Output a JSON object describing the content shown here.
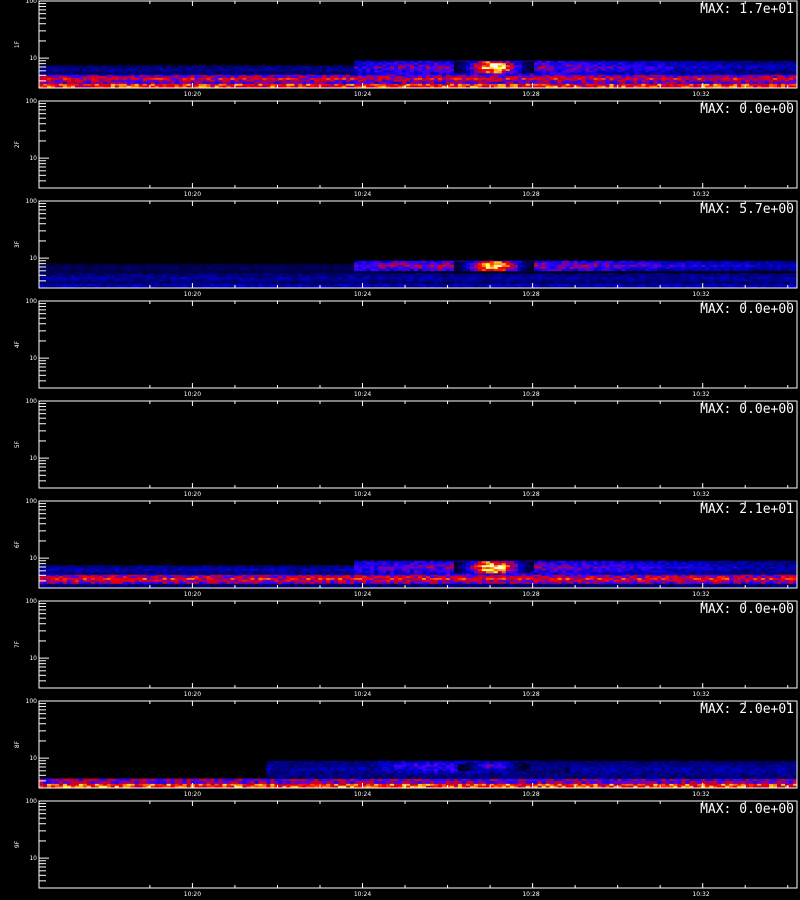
{
  "chart_data": [
    {
      "type": "heatmap",
      "panel_label": "1F",
      "max_label": "MAX: 1.7e+01",
      "max_value": 17,
      "y_ticklabels": [
        "100",
        "10"
      ],
      "x_ticklabels": [
        "10:20",
        "10:24",
        "10:28",
        "10:32"
      ],
      "features": [
        {
          "name": "baseline",
          "t": [
            0.0,
            1.0
          ],
          "y": [
            3.0,
            3.6
          ],
          "level": 0.9
        },
        {
          "name": "band2",
          "t": [
            0.0,
            1.0
          ],
          "y": [
            3.6,
            5.2
          ],
          "level": 0.55
        },
        {
          "name": "band3",
          "t": [
            0.0,
            0.45
          ],
          "y": [
            5.2,
            7.5
          ],
          "level": 0.18
        },
        {
          "name": "enhancement",
          "t": [
            0.42,
            1.0
          ],
          "y": [
            5.2,
            9.0
          ],
          "level": 0.45
        },
        {
          "name": "peak",
          "t": [
            0.55,
            0.65
          ],
          "y": [
            5.5,
            8.8
          ],
          "level": 1.0
        }
      ]
    },
    {
      "type": "heatmap",
      "panel_label": "2F",
      "max_label": "MAX: 0.0e+00",
      "max_value": 0,
      "y_ticklabels": [
        "100",
        "10"
      ],
      "x_ticklabels": [
        "10:20",
        "10:24",
        "10:28",
        "10:32"
      ],
      "features": []
    },
    {
      "type": "heatmap",
      "panel_label": "3F",
      "max_label": "MAX: 5.7e+00",
      "max_value": 5.7,
      "y_ticklabels": [
        "100",
        "10"
      ],
      "x_ticklabels": [
        "10:20",
        "10:24",
        "10:28",
        "10:32"
      ],
      "features": [
        {
          "name": "baseline",
          "t": [
            0.0,
            1.0
          ],
          "y": [
            3.0,
            3.6
          ],
          "level": 0.3
        },
        {
          "name": "band2",
          "t": [
            0.0,
            1.0
          ],
          "y": [
            3.6,
            5.5
          ],
          "level": 0.2
        },
        {
          "name": "band3",
          "t": [
            0.0,
            0.45
          ],
          "y": [
            5.5,
            8.0
          ],
          "level": 0.12
        },
        {
          "name": "enhancement",
          "t": [
            0.42,
            1.0
          ],
          "y": [
            6.0,
            9.0
          ],
          "level": 0.5
        },
        {
          "name": "peak",
          "t": [
            0.55,
            0.65
          ],
          "y": [
            6.0,
            8.8
          ],
          "level": 1.0
        }
      ]
    },
    {
      "type": "heatmap",
      "panel_label": "4F",
      "max_label": "MAX: 0.0e+00",
      "max_value": 0,
      "y_ticklabels": [
        "100",
        "10"
      ],
      "x_ticklabels": [
        "10:20",
        "10:24",
        "10:28",
        "10:32"
      ],
      "features": []
    },
    {
      "type": "heatmap",
      "panel_label": "5F",
      "max_label": "MAX: 0.0e+00",
      "max_value": 0,
      "y_ticklabels": [
        "100",
        "10"
      ],
      "x_ticklabels": [
        "10:20",
        "10:24",
        "10:28",
        "10:32"
      ],
      "features": []
    },
    {
      "type": "heatmap",
      "panel_label": "6F",
      "max_label": "MAX: 2.1e+01",
      "max_value": 21,
      "y_ticklabels": [
        "100",
        "10"
      ],
      "x_ticklabels": [
        "10:20",
        "10:24",
        "10:28",
        "10:32"
      ],
      "features": [
        {
          "name": "baseline",
          "t": [
            0.0,
            1.0
          ],
          "y": [
            3.0,
            3.6
          ],
          "level": 0.2
        },
        {
          "name": "band2",
          "t": [
            0.0,
            1.0
          ],
          "y": [
            3.6,
            5.2
          ],
          "level": 0.6
        },
        {
          "name": "band3",
          "t": [
            0.0,
            0.45
          ],
          "y": [
            5.2,
            7.5
          ],
          "level": 0.22
        },
        {
          "name": "enhancement",
          "t": [
            0.42,
            1.0
          ],
          "y": [
            5.2,
            9.0
          ],
          "level": 0.45
        },
        {
          "name": "peak",
          "t": [
            0.55,
            0.65
          ],
          "y": [
            5.5,
            8.8
          ],
          "level": 1.0
        }
      ]
    },
    {
      "type": "heatmap",
      "panel_label": "7F",
      "max_label": "MAX: 0.0e+00",
      "max_value": 0,
      "y_ticklabels": [
        "100",
        "10"
      ],
      "x_ticklabels": [
        "10:20",
        "10:24",
        "10:28",
        "10:32"
      ],
      "features": []
    },
    {
      "type": "heatmap",
      "panel_label": "8F",
      "max_label": "MAX: 2.0e+01",
      "max_value": 20,
      "y_ticklabels": [
        "100",
        "10"
      ],
      "x_ticklabels": [
        "10:20",
        "10:24",
        "10:28",
        "10:32"
      ],
      "features": [
        {
          "name": "baseline",
          "t": [
            0.0,
            1.0
          ],
          "y": [
            3.0,
            3.6
          ],
          "level": 0.95
        },
        {
          "name": "band2",
          "t": [
            0.0,
            1.0
          ],
          "y": [
            3.6,
            4.4
          ],
          "level": 0.6
        },
        {
          "name": "band3",
          "t": [
            0.3,
            1.0
          ],
          "y": [
            4.4,
            9.0
          ],
          "level": 0.2
        },
        {
          "name": "enhancement",
          "t": [
            0.45,
            0.7
          ],
          "y": [
            5.5,
            9.0
          ],
          "level": 0.35
        },
        {
          "name": "peak",
          "t": [
            0.55,
            0.65
          ],
          "y": [
            6.0,
            8.5
          ],
          "level": 0.4
        }
      ]
    },
    {
      "type": "heatmap",
      "panel_label": "9F",
      "max_label": "MAX: 0.0e+00",
      "max_value": 0,
      "y_ticklabels": [
        "100",
        "10"
      ],
      "x_ticklabels": [
        "10:20",
        "10:24",
        "10:28",
        "10:32"
      ],
      "features": []
    }
  ],
  "colors": {
    "background": "#000000",
    "axes": "#ffffff",
    "colormap": [
      "#000000",
      "#000060",
      "#0000d0",
      "#4000ff",
      "#c00030",
      "#ff0000",
      "#ff8000",
      "#ffff40",
      "#ffffe0"
    ]
  },
  "footer_text": ""
}
